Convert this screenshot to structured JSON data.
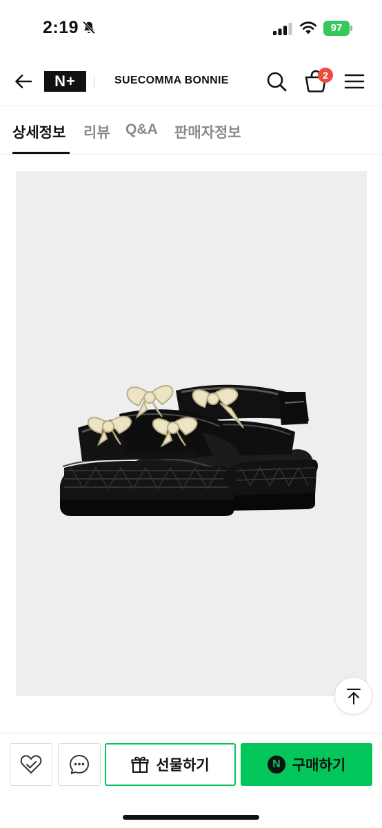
{
  "status_bar": {
    "time": "2:19",
    "battery": "97"
  },
  "header": {
    "logo_text": "N+",
    "store_name": "SUECOMMA BONNIE",
    "cart_count": "2"
  },
  "tabs": [
    {
      "label": "상세정보",
      "active": true
    },
    {
      "label": "리뷰",
      "active": false
    },
    {
      "label": "Q&A",
      "active": false
    },
    {
      "label": "판매자정보",
      "active": false
    }
  ],
  "product": {
    "image": "black-patent-platform-sandals-with-cream-bows"
  },
  "bottom_bar": {
    "gift_label": "선물하기",
    "buy_label": "구매하기",
    "buy_logo": "N"
  },
  "colors": {
    "accent_green": "#03c75a",
    "badge_red": "#ef4b3e",
    "battery_green": "#34c759"
  },
  "icons": [
    "bell-slash-icon",
    "signal-icon",
    "wifi-icon",
    "back-arrow-icon",
    "search-icon",
    "cart-icon",
    "menu-icon",
    "scroll-top-icon",
    "heart-check-icon",
    "chat-icon",
    "gift-icon"
  ]
}
